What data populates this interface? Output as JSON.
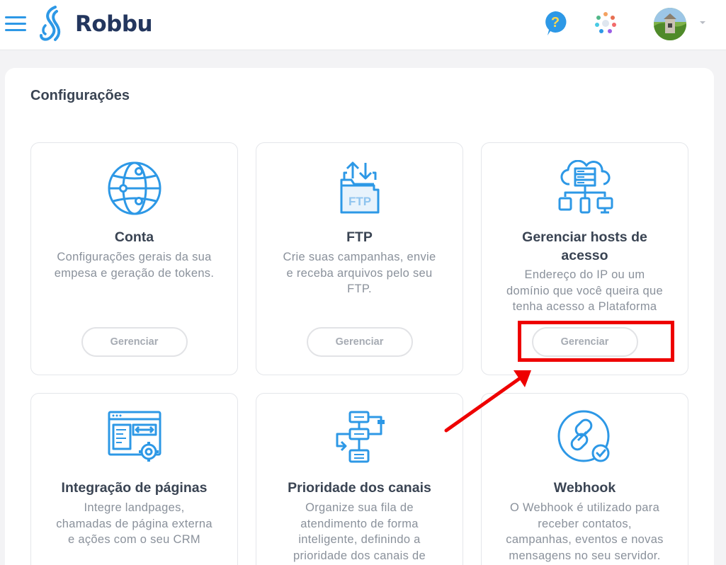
{
  "header": {
    "logo_text": "Robbu",
    "brand_color": "#2d98e6",
    "icons": [
      "menu-icon",
      "help-icon",
      "apps-icon",
      "avatar",
      "chevron-down-icon"
    ]
  },
  "page": {
    "title": "Configurações"
  },
  "cards": [
    {
      "id": "conta",
      "icon": "globe-icon",
      "title": "Conta",
      "desc": [
        "Configurações gerais da sua",
        "empesa e geração de tokens."
      ],
      "button": "Gerenciar"
    },
    {
      "id": "ftp",
      "icon": "ftp-folder-icon",
      "title": "FTP",
      "desc": [
        "Crie suas campanhas, envie",
        "e receba arquivos pelo seu",
        "FTP."
      ],
      "button": "Gerenciar"
    },
    {
      "id": "hosts",
      "icon": "cloud-network-icon",
      "title": [
        "Gerenciar hosts de",
        "acesso"
      ],
      "desc": [
        "Endereço do IP ou um",
        "domínio que você queira que",
        "tenha acesso a Plataforma"
      ],
      "button": "Gerenciar"
    },
    {
      "id": "integracao",
      "icon": "browser-settings-icon",
      "title": "Integração de páginas",
      "desc": [
        "Integre landpages,",
        "chamadas de página externa",
        "e ações com o seu CRM"
      ]
    },
    {
      "id": "prioridade",
      "icon": "flowchart-icon",
      "title": "Prioridade dos canais",
      "desc": [
        "Organize sua fila de",
        "atendimento de forma",
        "inteligente, definindo a",
        "prioridade dos canais de"
      ]
    },
    {
      "id": "webhook",
      "icon": "link-check-icon",
      "title": "Webhook",
      "desc": [
        "O Webhook é utilizado para",
        "receber contatos,",
        "campanhas, eventos e novas",
        "mensagens no seu servidor."
      ]
    }
  ],
  "annotation": {
    "color": "#ee0000",
    "target": "hosts-manage-button"
  }
}
